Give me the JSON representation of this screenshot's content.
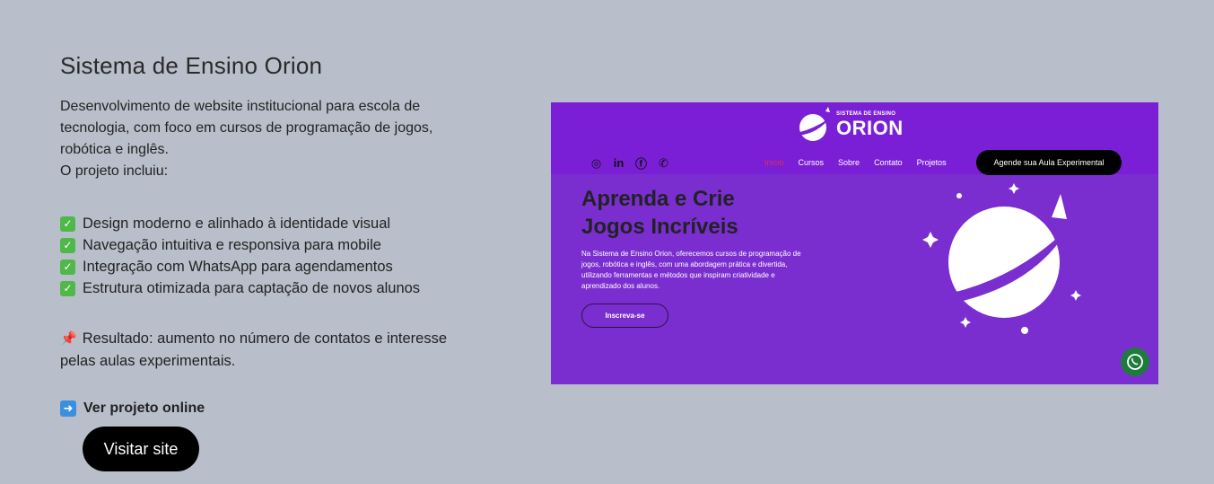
{
  "project": {
    "title": "Sistema de Ensino Orion",
    "description_lines": [
      "Desenvolvimento de website institucional para escola de",
      "tecnologia, com foco em cursos de programação de jogos,",
      "robótica e inglês.",
      "O projeto incluiu:"
    ],
    "features": [
      "Design moderno e alinhado à identidade visual",
      "Navegação intuitiva e responsiva para mobile",
      "Integração com WhatsApp para agendamentos",
      "Estrutura otimizada para captação de novos alunos"
    ],
    "result_lines": [
      "Resultado: aumento no número de contatos e interesse",
      "pelas aulas experimentais."
    ],
    "online_label": "Ver projeto online",
    "visit_button": "Visitar site"
  },
  "preview": {
    "logo_small": "SISTEMA DE ENSINO",
    "logo_big": "ORION",
    "nav": [
      "Início",
      "Cursos",
      "Sobre",
      "Contato",
      "Projetos"
    ],
    "cta": "Agende sua Aula Experimental",
    "hero_title_lines": [
      "Aprenda e Crie",
      "Jogos Incríveis"
    ],
    "hero_text": "Na Sistema de Ensino Orion, oferecemos cursos de programação de jogos, robótica e inglês, com uma abordagem prática e divertida, utilizando ferramentas e métodos que inspiram criatividade e aprendizado dos alunos.",
    "hero_button": "Inscreva-se"
  },
  "colors": {
    "background": "#b8bfca",
    "preview_purple": "#7a2ed0",
    "button_black": "#000000",
    "whatsapp_green": "#1e7b3e"
  }
}
